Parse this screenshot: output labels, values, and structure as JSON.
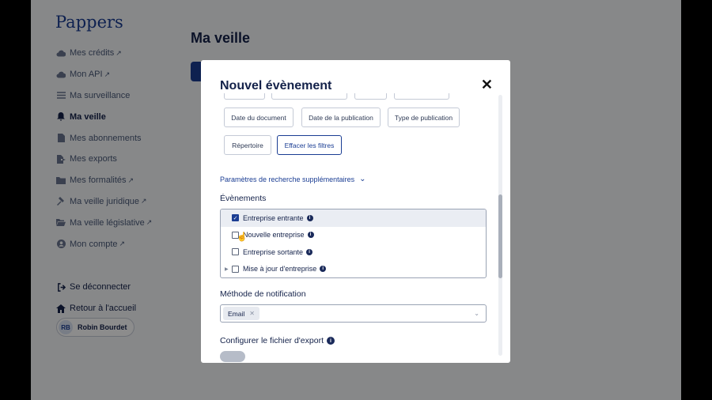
{
  "app": {
    "brand": "Pappers"
  },
  "sidebar": {
    "items": [
      {
        "label": "Mes crédits",
        "icon": "cloud-icon",
        "external": true,
        "active": false
      },
      {
        "label": "Mon API",
        "icon": "cloud-icon",
        "external": true,
        "active": false
      },
      {
        "label": "Ma surveillance",
        "icon": "list-icon",
        "external": false,
        "active": false
      },
      {
        "label": "Ma veille",
        "icon": "bell-icon",
        "external": false,
        "active": true
      },
      {
        "label": "Mes abonnements",
        "icon": "document-icon",
        "external": false,
        "active": false
      },
      {
        "label": "Mes exports",
        "icon": "file-export-icon",
        "external": false,
        "active": false
      },
      {
        "label": "Mes formalités",
        "icon": "folder-icon",
        "external": true,
        "active": false
      },
      {
        "label": "Ma veille juridique",
        "icon": "gavel-icon",
        "external": true,
        "active": false
      },
      {
        "label": "Ma veille législative",
        "icon": "folder-open-icon",
        "external": true,
        "active": false
      },
      {
        "label": "Mon compte",
        "icon": "user-circle-icon",
        "external": true,
        "active": false
      }
    ],
    "logout_label": "Se déconnecter",
    "home_label": "Retour à l'accueil",
    "user": {
      "initials": "RB",
      "name": "Robin Bourdet"
    }
  },
  "page": {
    "title": "Ma veille"
  },
  "modal": {
    "title": "Nouvel évènement",
    "filters": {
      "row2": [
        "Date du document",
        "Date de la publication",
        "Type de publication"
      ],
      "row3": [
        "Répertoire",
        "Effacer les filtres"
      ]
    },
    "advanced_label": "Paramètres de recherche supplémentaires",
    "events_heading": "Évènements",
    "events": [
      {
        "label": "Entreprise entrante",
        "checked": true
      },
      {
        "label": "Nouvelle entreprise",
        "checked": false
      },
      {
        "label": "Entreprise sortante",
        "checked": false
      },
      {
        "label": "Mise à jour d'entreprise",
        "checked": false
      }
    ],
    "notification_heading": "Méthode de notification",
    "notification_selected": "Email",
    "export_heading": "Configurer le fichier d'export"
  },
  "colors": {
    "accent": "#1a3d93",
    "text": "#14224a",
    "muted": "#4a5a78"
  }
}
